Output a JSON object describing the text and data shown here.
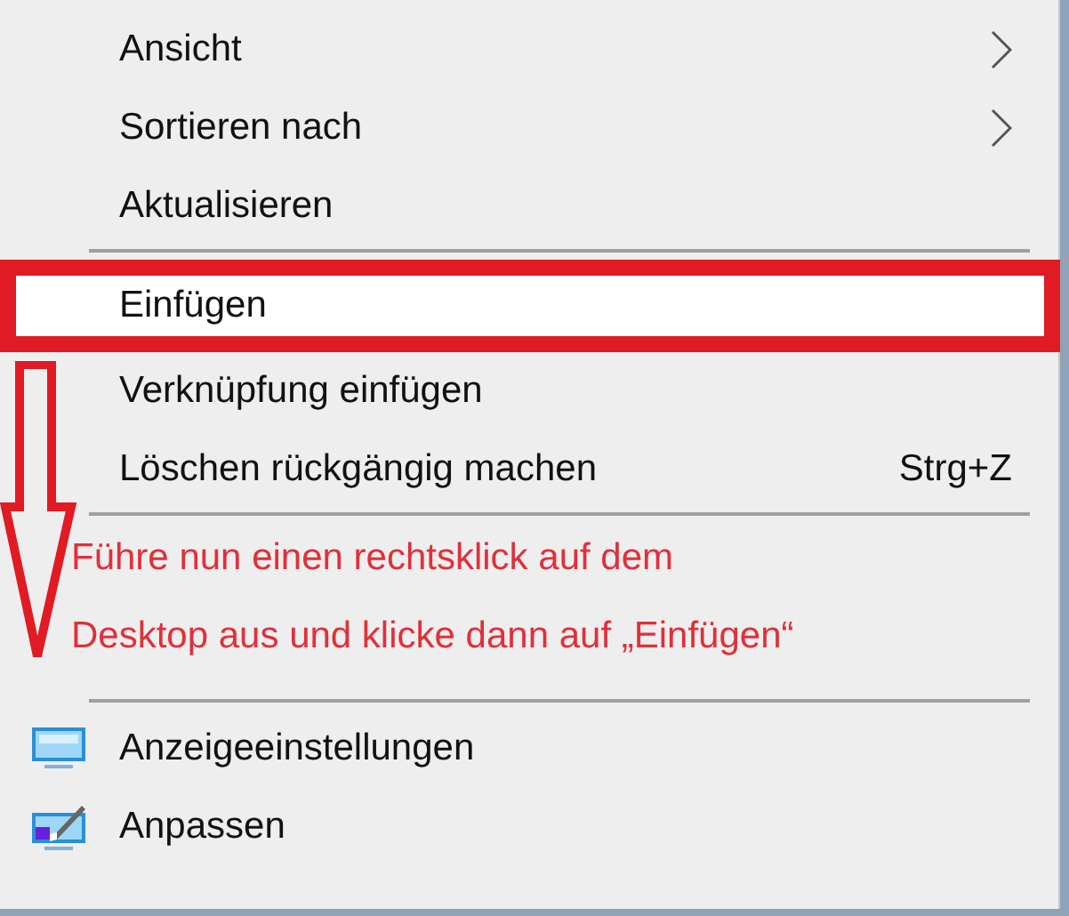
{
  "menu": {
    "items": [
      {
        "kind": "item",
        "label": "Ansicht",
        "submenu": true,
        "highlighted": false
      },
      {
        "kind": "item",
        "label": "Sortieren nach",
        "submenu": true,
        "highlighted": false
      },
      {
        "kind": "item",
        "label": "Aktualisieren",
        "submenu": false,
        "highlighted": false
      },
      {
        "kind": "separator"
      },
      {
        "kind": "item",
        "label": "Einfügen",
        "submenu": false,
        "highlighted": true
      },
      {
        "kind": "item",
        "label": "Verknüpfung einfügen",
        "submenu": false,
        "highlighted": false
      },
      {
        "kind": "item",
        "label": "Löschen rückgängig machen",
        "shortcut": "Strg+Z",
        "submenu": false,
        "highlighted": false
      },
      {
        "kind": "separator"
      },
      {
        "kind": "note",
        "lines": [
          "Führe nun einen rechtsklick auf dem",
          "Desktop aus und klicke dann auf „Einfügen“"
        ]
      },
      {
        "kind": "separator"
      },
      {
        "kind": "display",
        "label": "Anzeigeeinstellungen",
        "submenu": false,
        "highlighted": false
      },
      {
        "kind": "personalize",
        "label": "Anpassen",
        "submenu": false,
        "highlighted": false
      }
    ]
  }
}
